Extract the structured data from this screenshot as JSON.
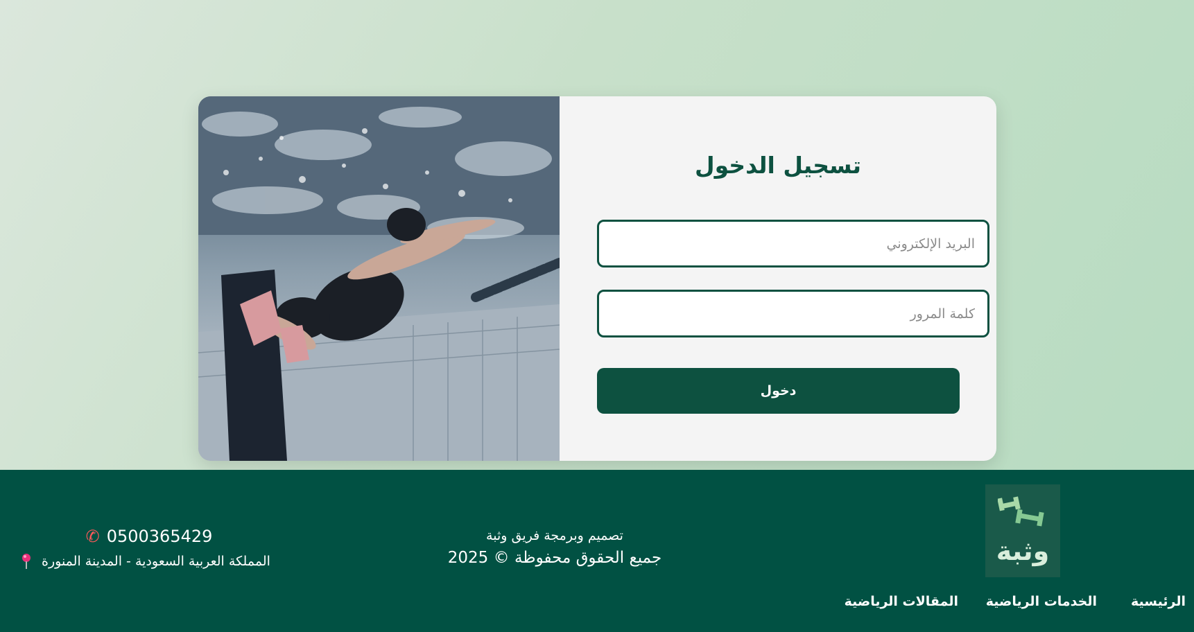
{
  "login": {
    "title": "تسجيل الدخول",
    "email_placeholder": "البريد الإلكتروني",
    "password_placeholder": "كلمة المرور",
    "submit_label": "دخول"
  },
  "footer": {
    "logo_text": "وثبة",
    "credits_line": "تصميم وبرمجة فريق وثبة",
    "copyright": "جميع الحقوق محفوظة © 2025",
    "phone": "0500365429",
    "address": "المملكة العربية السعودية - المدينة المنورة",
    "nav": {
      "home": "الرئيسية",
      "services": "الخدمات الرياضية",
      "articles": "المقالات الرياضية"
    }
  },
  "colors": {
    "primary": "#0d5140",
    "footer_bg": "#015143",
    "card_bg": "#f4f4f4",
    "phone_icon": "#ff5a5a",
    "pin_icon": "#e8307a"
  },
  "icons": [
    "swimmer-photo",
    "logo-dumbbell-icon",
    "phone-icon",
    "location-pin-icon"
  ]
}
